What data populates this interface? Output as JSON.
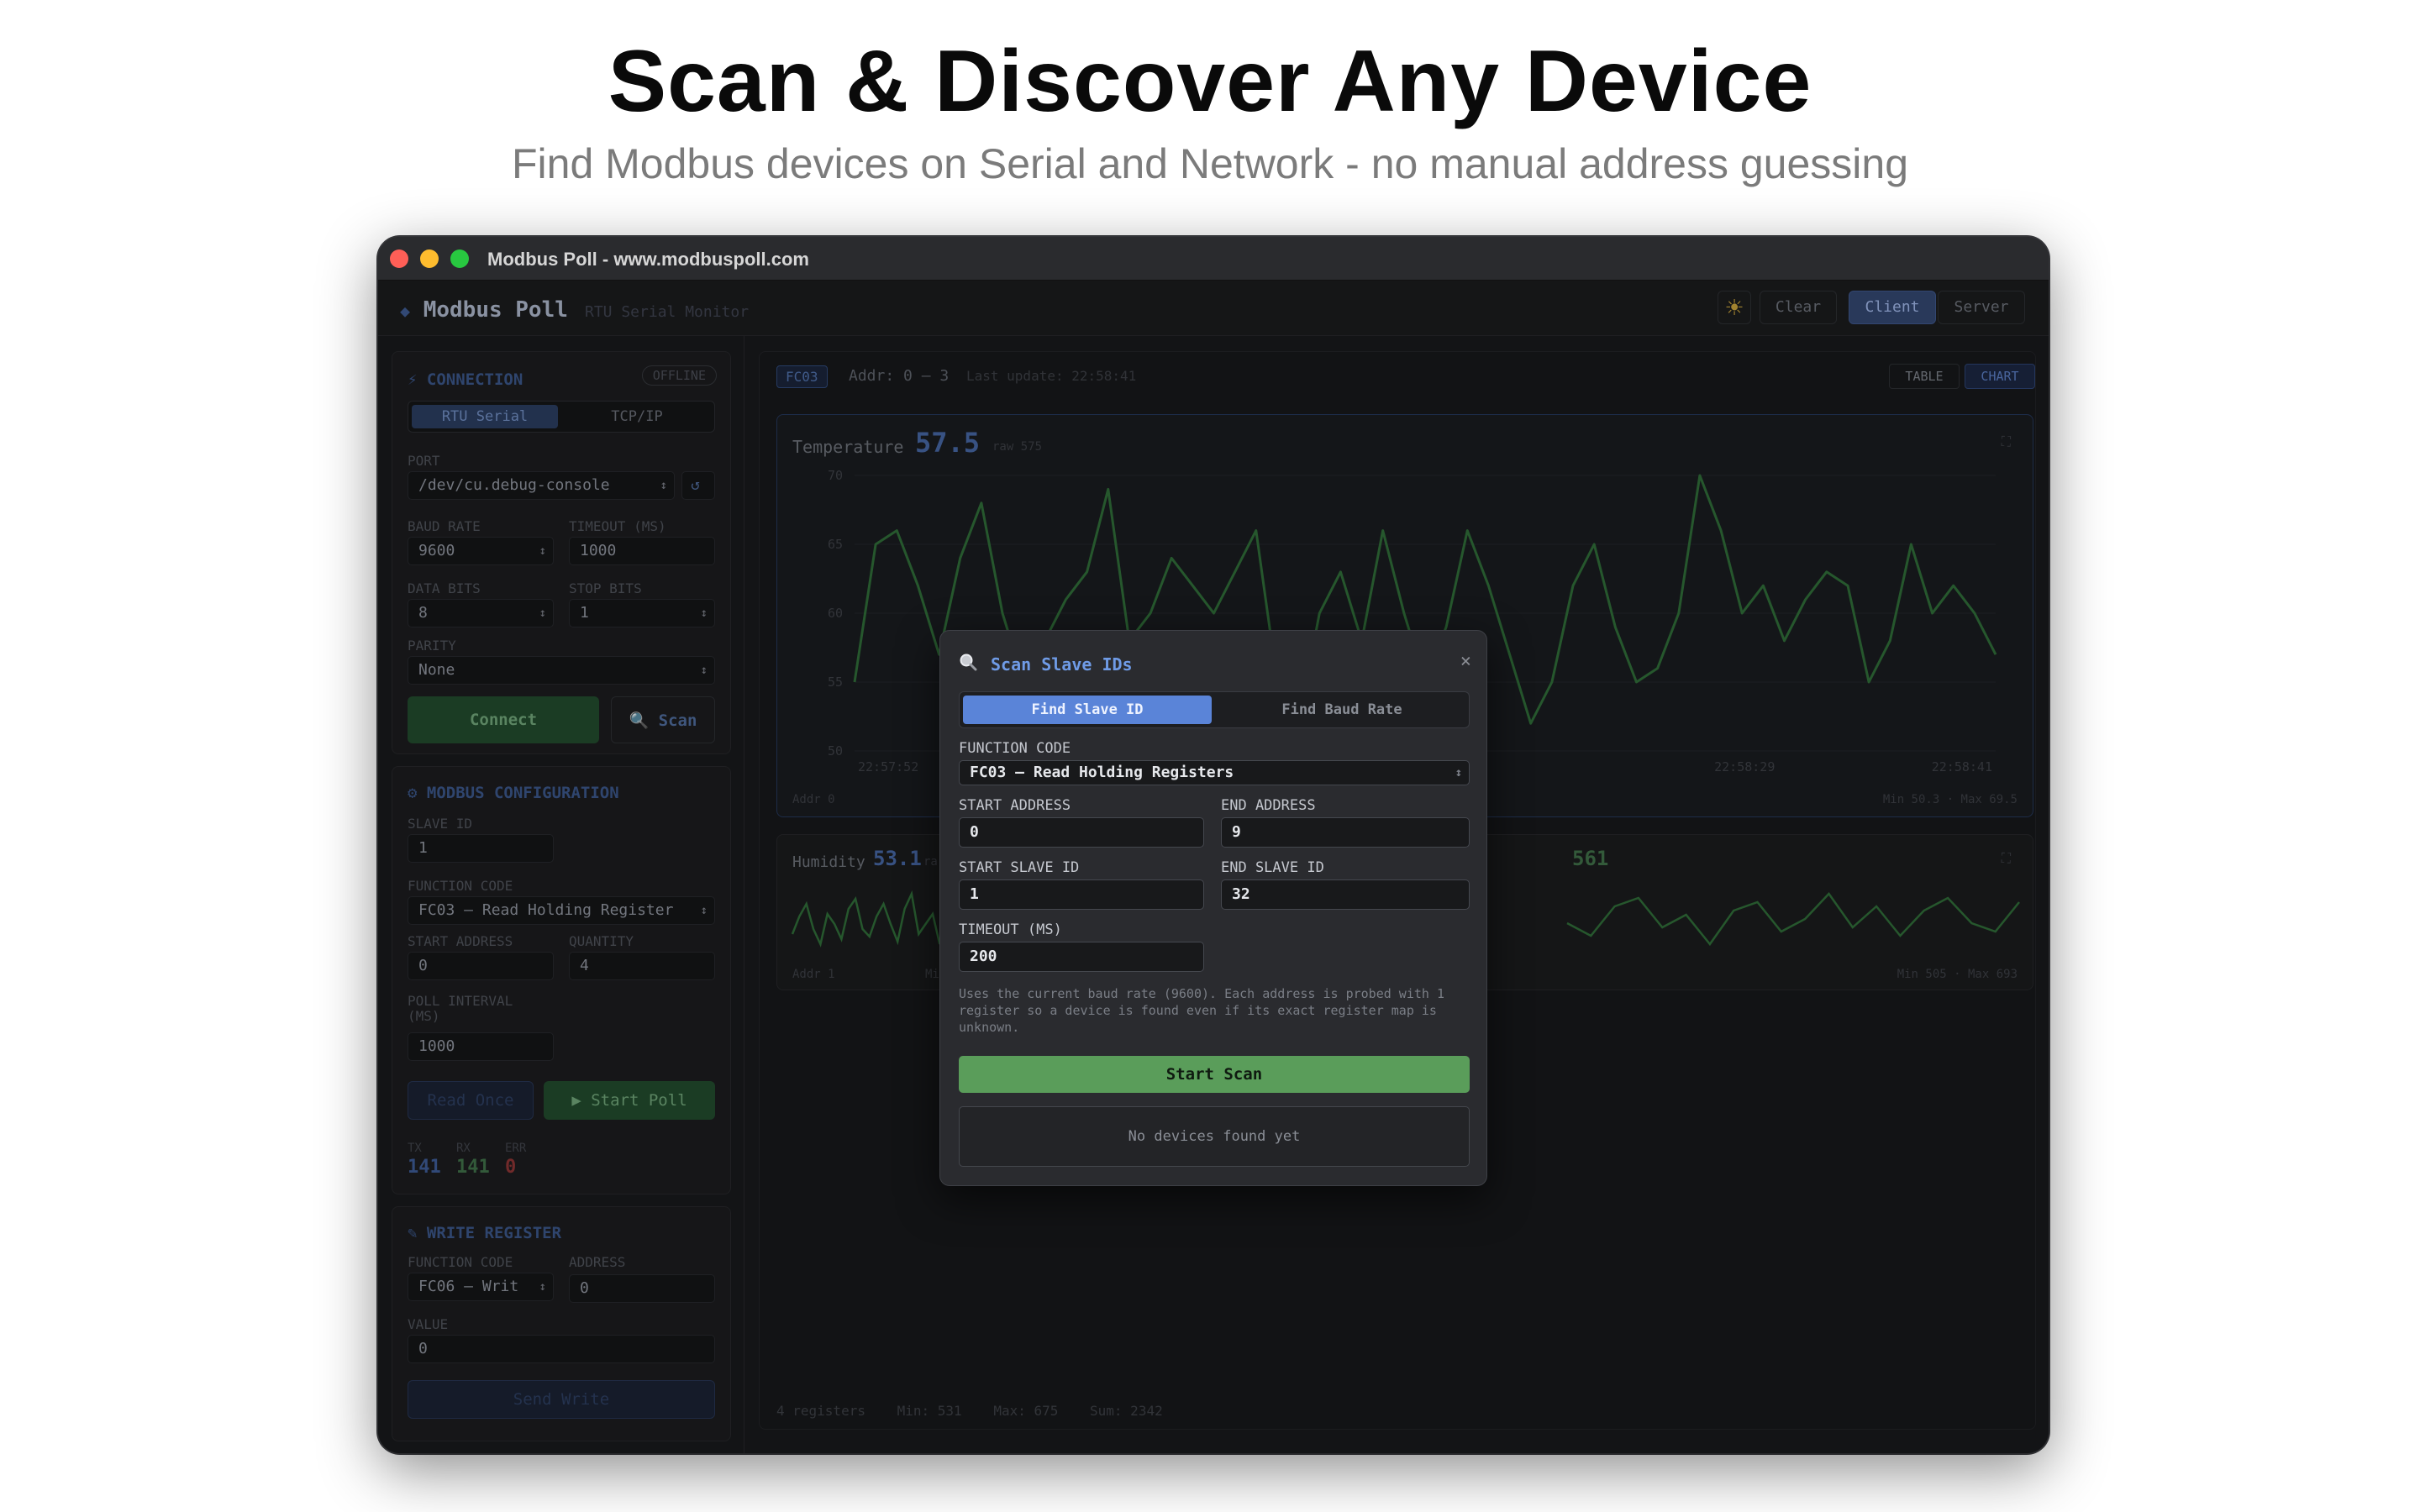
{
  "hero": {
    "title": "Scan & Discover Any Device",
    "subtitle": "Find Modbus devices on Serial and Network - no manual address guessing"
  },
  "window": {
    "title": "Modbus Poll - www.modbuspoll.com"
  },
  "appbar": {
    "brand": "Modbus Poll",
    "subtitle": "RTU Serial Monitor",
    "theme_icon": "sun-icon",
    "clear": "Clear",
    "client": "Client",
    "server": "Server"
  },
  "connection": {
    "title": "CONNECTION",
    "status": "OFFLINE",
    "tabs": [
      "RTU Serial",
      "TCP/IP"
    ],
    "port_label": "PORT",
    "port_value": "/dev/cu.debug-console",
    "baud_label": "BAUD RATE",
    "baud_value": "9600",
    "timeout_label": "TIMEOUT (MS)",
    "timeout_value": "1000",
    "data_bits_label": "DATA BITS",
    "data_bits_value": "8",
    "stop_bits_label": "STOP BITS",
    "stop_bits_value": "1",
    "parity_label": "PARITY",
    "parity_value": "None",
    "connect": "Connect",
    "scan": "Scan"
  },
  "modbus_config": {
    "title": "MODBUS CONFIGURATION",
    "slave_label": "SLAVE ID",
    "slave_value": "1",
    "fc_label": "FUNCTION CODE",
    "fc_value": "FC03 — Read Holding Register",
    "start_label": "START ADDRESS",
    "start_value": "0",
    "qty_label": "QUANTITY",
    "qty_value": "4",
    "poll_label": "POLL INTERVAL (MS)",
    "poll_value": "1000",
    "read_once": "Read Once",
    "start_poll": "▶ Start Poll",
    "tx_label": "TX",
    "tx": "141",
    "rx_label": "RX",
    "rx": "141",
    "err_label": "ERR",
    "err": "0"
  },
  "write_register": {
    "title": "WRITE REGISTER",
    "fc_label": "FUNCTION CODE",
    "fc_value": "FC06 — Writ",
    "addr_label": "ADDRESS",
    "addr_value": "0",
    "value_label": "VALUE",
    "value_value": "0",
    "send": "Send Write"
  },
  "main_header": {
    "tag": "FC03",
    "addr": "Addr: 0 – 3",
    "last_update": "Last update: 22:58:41",
    "table": "TABLE",
    "chart": "CHART"
  },
  "temperature_card": {
    "label": "Temperature",
    "value": "57.5",
    "raw": "raw 575",
    "addr": "Addr 0",
    "minmax": "Min 50.3 · Max 69.5",
    "y_ticks": [
      "70",
      "65",
      "60",
      "55",
      "50"
    ],
    "x_ticks": [
      "22:57:52",
      "22:58:29",
      "22:58:41"
    ]
  },
  "humidity_card": {
    "label": "Humidity",
    "value": "53.1",
    "raw": "ra",
    "addr": "Addr 1",
    "addr_cut": "Mi"
  },
  "third_card": {
    "value": "561",
    "minmax": "Min 505 · Max 693"
  },
  "footer": {
    "registers": "4 registers",
    "min": "Min: 531",
    "max": "Max: 675",
    "sum": "Sum: 2342"
  },
  "scan_modal": {
    "title": "Scan Slave IDs",
    "close": "×",
    "tabs": [
      "Find Slave ID",
      "Find Baud Rate"
    ],
    "fc_label": "FUNCTION CODE",
    "fc_value": "FC03 — Read Holding Registers",
    "start_addr_label": "START ADDRESS",
    "start_addr_value": "0",
    "end_addr_label": "END ADDRESS",
    "end_addr_value": "9",
    "start_slave_label": "START SLAVE ID",
    "start_slave_value": "1",
    "end_slave_label": "END SLAVE ID",
    "end_slave_value": "32",
    "timeout_label": "TIMEOUT (MS)",
    "timeout_value": "200",
    "help": "Uses the current baud rate (9600). Each address is probed with 1 register so a device is found even if its exact register map is unknown.",
    "start_scan": "Start Scan",
    "empty": "No devices found yet"
  },
  "chart_data": {
    "type": "line",
    "title": "",
    "ylim": [
      50,
      70
    ],
    "y_ticks": [
      70,
      65,
      60,
      55,
      50
    ],
    "x_tick_labels": [
      "22:57:52",
      "22:58:29",
      "22:58:41"
    ],
    "series": [
      {
        "name": "Temperature",
        "values": [
          55,
          65,
          66,
          62,
          57,
          64,
          68,
          60,
          55,
          58,
          61,
          63,
          69,
          58,
          60,
          64,
          62,
          60,
          63,
          66,
          55,
          52,
          60,
          63,
          58,
          66,
          60,
          55,
          59,
          66,
          62,
          57,
          52,
          55,
          62,
          65,
          59,
          55,
          56,
          60,
          70,
          66,
          60,
          62,
          58,
          61,
          63,
          62,
          55,
          58,
          65,
          60,
          62,
          60,
          57
        ]
      }
    ],
    "humidity_series": [
      48,
      55,
      60,
      50,
      44,
      56,
      52,
      46,
      58,
      62,
      50,
      47,
      55,
      60,
      52,
      45,
      58,
      64,
      48,
      52,
      56,
      44,
      60,
      50
    ],
    "third_series": [
      50,
      44,
      58,
      62,
      48,
      54,
      40,
      56,
      60,
      46,
      52,
      64,
      48,
      58,
      44,
      56,
      62,
      50,
      46,
      60
    ]
  }
}
